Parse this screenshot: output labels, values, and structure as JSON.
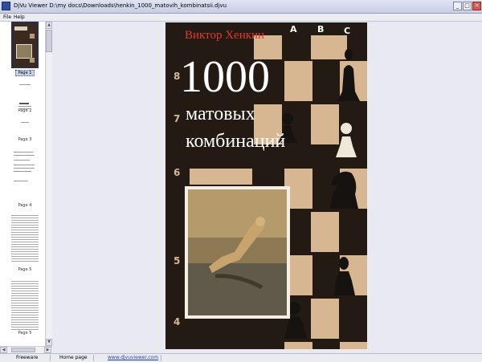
{
  "window": {
    "title": "DjVu Viewer   D:\\my docs\\Downloads\\henkin_1000_matovih_kombinatsii.djvu",
    "minimize": "_",
    "maximize": "□",
    "close": "✕"
  },
  "menu": [
    "File",
    "Help"
  ],
  "thumbnails": {
    "labels": [
      "Page 1",
      "Page 2",
      "Page 3",
      "Page 4",
      "Page 5"
    ]
  },
  "cover": {
    "author": "Виктор Хенкин",
    "number": "1000",
    "line1": "матовых",
    "line2": "комбинаций",
    "files": [
      "A",
      "B",
      "C"
    ],
    "ranks": [
      "8",
      "7",
      "6",
      "5",
      "4"
    ]
  },
  "status": {
    "freeware": "Freeware",
    "home": "Home page",
    "url": "www.djvuviewer.com"
  },
  "colors": {
    "cover_bg": "#241a14",
    "square_light": "#d7b792",
    "title_red": "#e33a2e",
    "link": "#1c3fc0"
  },
  "scroll_arrows": {
    "up": "▲",
    "down": "▼",
    "left": "◀",
    "right": "▶"
  }
}
